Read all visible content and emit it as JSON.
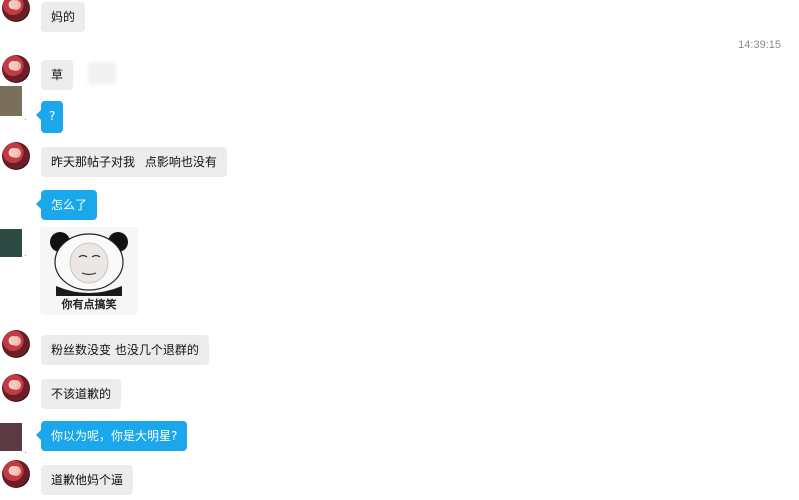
{
  "conversation": {
    "timestamp": "14:39:15",
    "messages": [
      {
        "text": "妈的"
      },
      {
        "text": "草"
      },
      {
        "text": "?"
      },
      {
        "text": "昨天那帖子对我 点影响也没有"
      },
      {
        "text": "怎么了"
      },
      {
        "sticker_caption": "你有点搞笑"
      },
      {
        "text": "粉丝数没变 也没几个退群的"
      },
      {
        "text": "不该道歉的"
      },
      {
        "text": "你以为呢，你是大明星?"
      },
      {
        "text": "道歉他妈个逼"
      }
    ]
  },
  "colors": {
    "incoming_bubble": "#ececec",
    "outgoing_bubble": "#1aa7ec",
    "timestamp": "#8a8a8a"
  },
  "icons": {
    "incoming_avatar": "anime-avatar-icon",
    "sticker": "panda-meme-sticker"
  }
}
